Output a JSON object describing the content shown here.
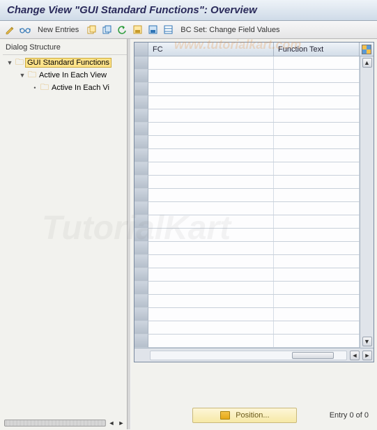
{
  "title": "Change View \"GUI Standard Functions\": Overview",
  "toolbar": {
    "new_entries_label": "New Entries",
    "bcset_label": "BC Set: Change Field Values"
  },
  "tree": {
    "title": "Dialog Structure",
    "nodes": [
      {
        "label": "GUI Standard Functions",
        "depth": 0,
        "expanded": true,
        "selected": true
      },
      {
        "label": "Active In Each View",
        "depth": 1,
        "expanded": true,
        "selected": false
      },
      {
        "label": "Active In Each Vi",
        "depth": 2,
        "expanded": false,
        "selected": false
      }
    ]
  },
  "grid": {
    "columns": {
      "fc": "FC",
      "ft": "Function Text"
    },
    "rows": [
      {},
      {},
      {},
      {},
      {},
      {},
      {},
      {},
      {},
      {},
      {},
      {},
      {},
      {},
      {},
      {},
      {},
      {},
      {},
      {},
      {},
      {}
    ]
  },
  "footer": {
    "position_label": "Position...",
    "entry_count_label": "Entry 0 of 0"
  },
  "watermark": {
    "line1": "www.tutorialkart.com",
    "line2": "TutorialKart"
  }
}
